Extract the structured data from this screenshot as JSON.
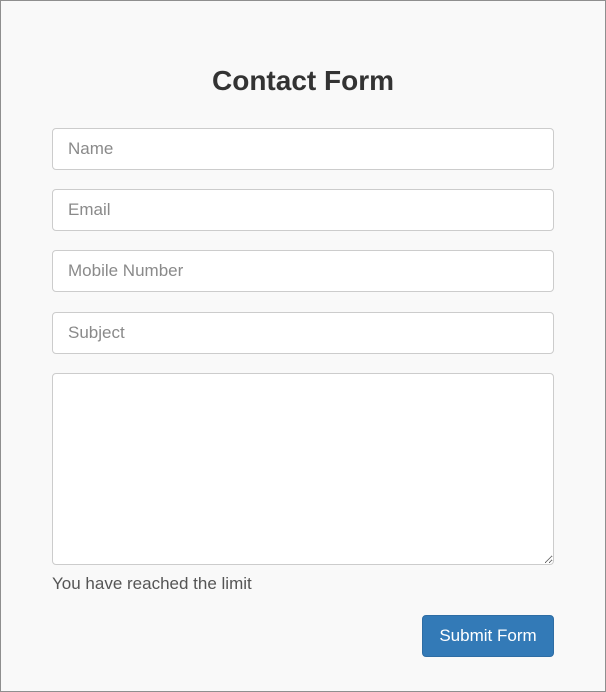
{
  "form": {
    "title": "Contact Form",
    "name_placeholder": "Name",
    "email_placeholder": "Email",
    "mobile_placeholder": "Mobile Number",
    "subject_placeholder": "Subject",
    "message_value": "",
    "limit_message": "You have reached the limit",
    "submit_label": "Submit Form"
  },
  "colors": {
    "background": "#f9f9f9",
    "title_text": "#333333",
    "input_border": "#cccccc",
    "button_background": "#337ab7",
    "button_text": "#ffffff"
  }
}
